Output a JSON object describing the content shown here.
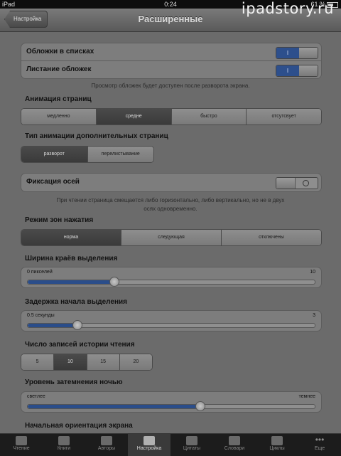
{
  "status": {
    "device": "iPad",
    "time": "0:24",
    "battery": "61 %"
  },
  "watermark": "ipadstory.ru",
  "nav": {
    "back": "Настройка",
    "title": "Расширенные"
  },
  "covers": {
    "rows": [
      {
        "label": "Обложки в списках",
        "switch": "I"
      },
      {
        "label": "Листание обложек",
        "switch": "I"
      }
    ],
    "note": "Просмотр обложек будет доступен после разворота экрана."
  },
  "animation": {
    "title": "Анимация страниц",
    "options": [
      "медленно",
      "средне",
      "быстро",
      "отсутсвует"
    ],
    "selected": 1
  },
  "anim_type": {
    "title": "Тип анимации дополнительных страниц",
    "options": [
      "разворот",
      "перелистывание"
    ],
    "selected": 0
  },
  "axis_lock": {
    "label": "Фиксация осей",
    "note_line1": "При чтении страница смещается либо горизонтально, либо вертикально, но не в двух",
    "note_line2": "осях одновременно."
  },
  "tap_zones": {
    "title": "Режим зон нажатия",
    "options": [
      "норма",
      "следующая",
      "отключены"
    ],
    "selected": 0
  },
  "edge_width": {
    "title": "Ширина краёв выделения",
    "min": "0 пикселей",
    "max": "10",
    "value": 0.3
  },
  "select_delay": {
    "title": "Задержка начала выделения",
    "min": "0.5 секунды",
    "max": "3",
    "value": 0.17
  },
  "history": {
    "title": "Число записей истории чтения",
    "options": [
      "5",
      "10",
      "15",
      "20"
    ],
    "selected": 1
  },
  "night": {
    "title": "Уровень затемнения ночью",
    "min": "светлее",
    "max": "темнее",
    "value": 0.6
  },
  "orientation": {
    "title": "Начальная ориентация экрана"
  },
  "tabs": [
    {
      "label": "Чтение",
      "icon": "book-reading-icon"
    },
    {
      "label": "Книги",
      "icon": "books-icon"
    },
    {
      "label": "Авторы",
      "icon": "authors-icon"
    },
    {
      "label": "Настройка",
      "icon": "settings-icon"
    },
    {
      "label": "Цитаты",
      "icon": "quotes-icon"
    },
    {
      "label": "Словари",
      "icon": "dictionary-icon"
    },
    {
      "label": "Циклы",
      "icon": "series-icon"
    },
    {
      "label": "Еще",
      "icon": "more-icon"
    }
  ],
  "selected_tab": 3
}
